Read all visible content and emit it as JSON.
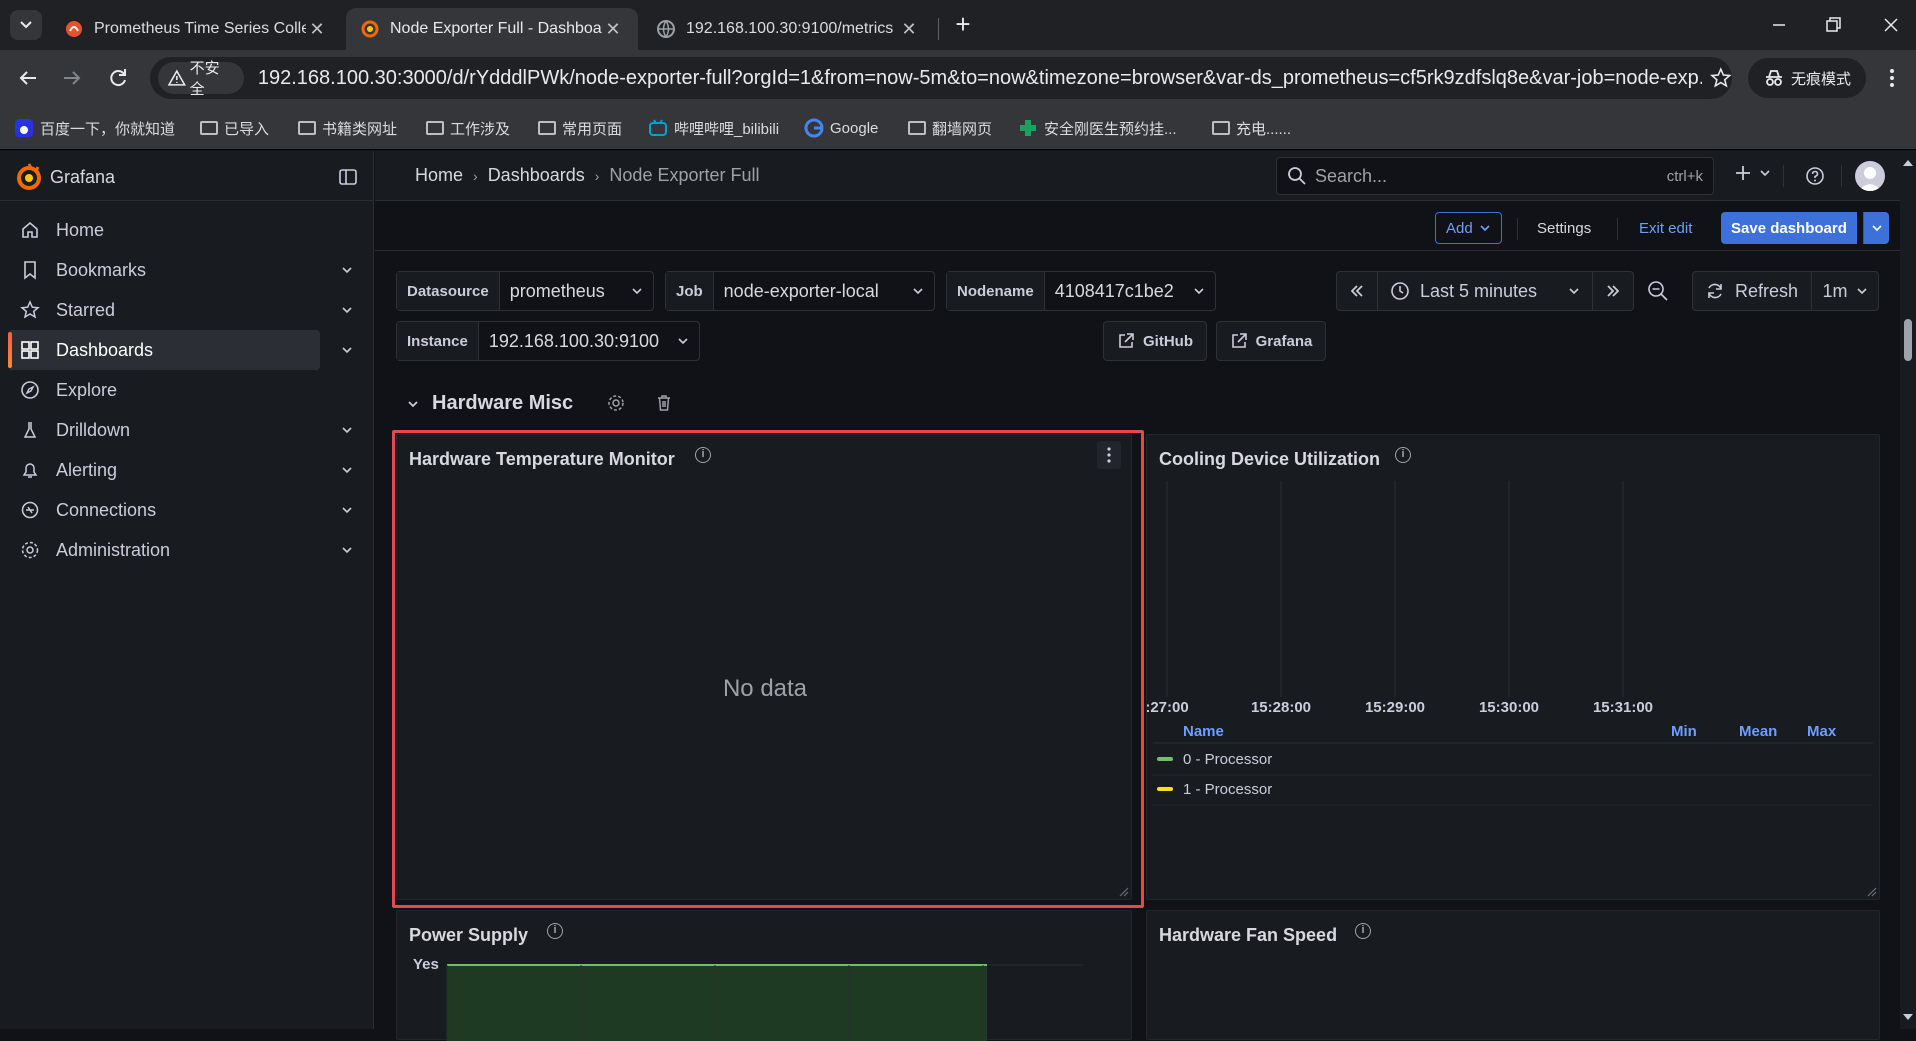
{
  "browser": {
    "tabs": [
      {
        "title": "Prometheus Time Series Colle",
        "active": false
      },
      {
        "title": "Node Exporter Full - Dashboa",
        "active": true
      },
      {
        "title": "192.168.100.30:9100/metrics",
        "active": false
      }
    ],
    "not_secure_label": "不安全",
    "url": "192.168.100.30:3000/d/rYdddlPWk/node-exporter-full?orgId=1&from=now-5m&to=now&timezone=browser&var-ds_prometheus=cf5rk9zdfslq8e&var-job=node-exp...",
    "incognito_label": "无痕模式",
    "bookmarks": [
      "百度一下，你就知道",
      "已导入",
      "书籍类网址",
      "工作涉及",
      "常用页面",
      "哔哩哔哩_bilibili",
      "Google",
      "翻墙网页",
      "安全刚医生预约挂...",
      "充电......"
    ]
  },
  "grafana": {
    "brand": "Grafana",
    "breadcrumb": [
      "Home",
      "Dashboards",
      "Node Exporter Full"
    ],
    "search_placeholder": "Search...",
    "search_shortcut": "ctrl+k",
    "nav": [
      {
        "label": "Home",
        "icon": "home-icon",
        "expandable": false,
        "active": false
      },
      {
        "label": "Bookmarks",
        "icon": "bookmark-icon",
        "expandable": true,
        "active": false
      },
      {
        "label": "Starred",
        "icon": "star-icon",
        "expandable": true,
        "active": false
      },
      {
        "label": "Dashboards",
        "icon": "apps-icon",
        "expandable": true,
        "active": true
      },
      {
        "label": "Explore",
        "icon": "compass-icon",
        "expandable": false,
        "active": false
      },
      {
        "label": "Drilldown",
        "icon": "drilldown-icon",
        "expandable": true,
        "active": false
      },
      {
        "label": "Alerting",
        "icon": "bell-icon",
        "expandable": true,
        "active": false
      },
      {
        "label": "Connections",
        "icon": "connections-icon",
        "expandable": true,
        "active": false
      },
      {
        "label": "Administration",
        "icon": "cog-icon",
        "expandable": true,
        "active": false
      }
    ],
    "actions": {
      "add": "Add",
      "settings": "Settings",
      "exit_edit": "Exit edit",
      "save": "Save dashboard"
    },
    "variables": [
      {
        "label": "Datasource",
        "value": "prometheus"
      },
      {
        "label": "Job",
        "value": "node-exporter-local"
      },
      {
        "label": "Nodename",
        "value": "4108417c1be2"
      },
      {
        "label": "Instance",
        "value": "192.168.100.30:9100"
      }
    ],
    "time_range": "Last 5 minutes",
    "refresh_label": "Refresh",
    "refresh_interval": "1m",
    "links": [
      "GitHub",
      "Grafana"
    ],
    "row_title": "Hardware Misc",
    "panels": {
      "temp": {
        "title": "Hardware Temperature Monitor",
        "message": "No data"
      },
      "cooling": {
        "title": "Cooling Device Utilization"
      },
      "power": {
        "title": "Power Supply"
      },
      "fan": {
        "title": "Hardware Fan Speed"
      }
    },
    "colors": {
      "accent": "#3d71d9",
      "highlight_border": "#e5484d",
      "series_green": "#73bf69",
      "series_yellow": "#fade2a"
    }
  },
  "chart_data": [
    {
      "type": "line",
      "title": "Cooling Device Utilization",
      "x_ticks": [
        ":27:00",
        "15:28:00",
        "15:29:00",
        "15:30:00",
        "15:31:00"
      ],
      "series": [
        {
          "name": "0 - Processor",
          "color": "#73bf69",
          "values": []
        },
        {
          "name": "1 - Processor",
          "color": "#fade2a",
          "values": []
        }
      ],
      "legend_columns": [
        "Name",
        "Min",
        "Mean",
        "Max"
      ],
      "legend": "bottom"
    },
    {
      "type": "area",
      "title": "Power Supply",
      "y_ticks": [
        "Yes"
      ],
      "series": [
        {
          "color": "#73bf69",
          "values": []
        }
      ]
    }
  ]
}
